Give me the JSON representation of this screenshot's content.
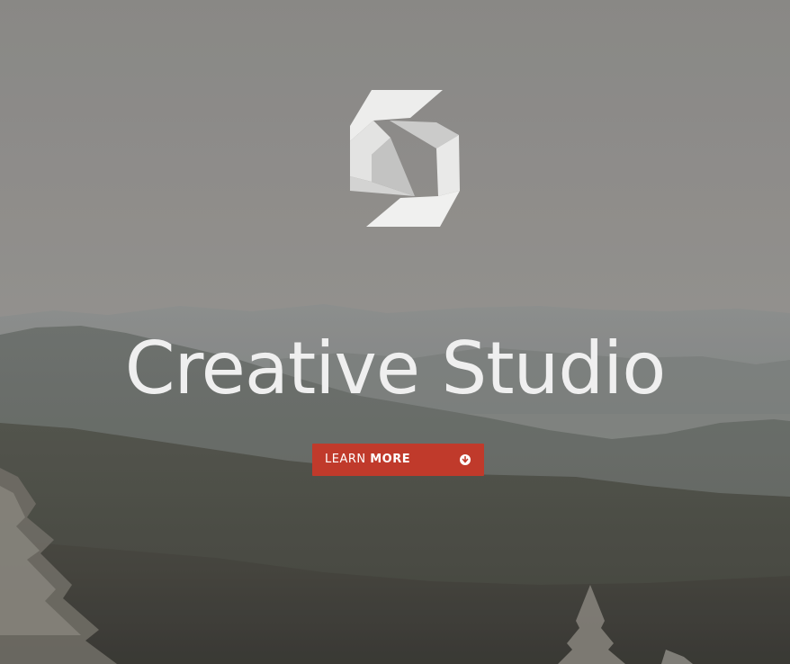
{
  "hero": {
    "title": "Creative Studio",
    "cta": {
      "label_light": "LEARN",
      "label_bold": "MORE",
      "icon": "arrow-down-circle-icon",
      "color": "#c03a2b"
    },
    "logo_icon": "studio-logo-mark",
    "background": "mountain-landscape-photo"
  }
}
